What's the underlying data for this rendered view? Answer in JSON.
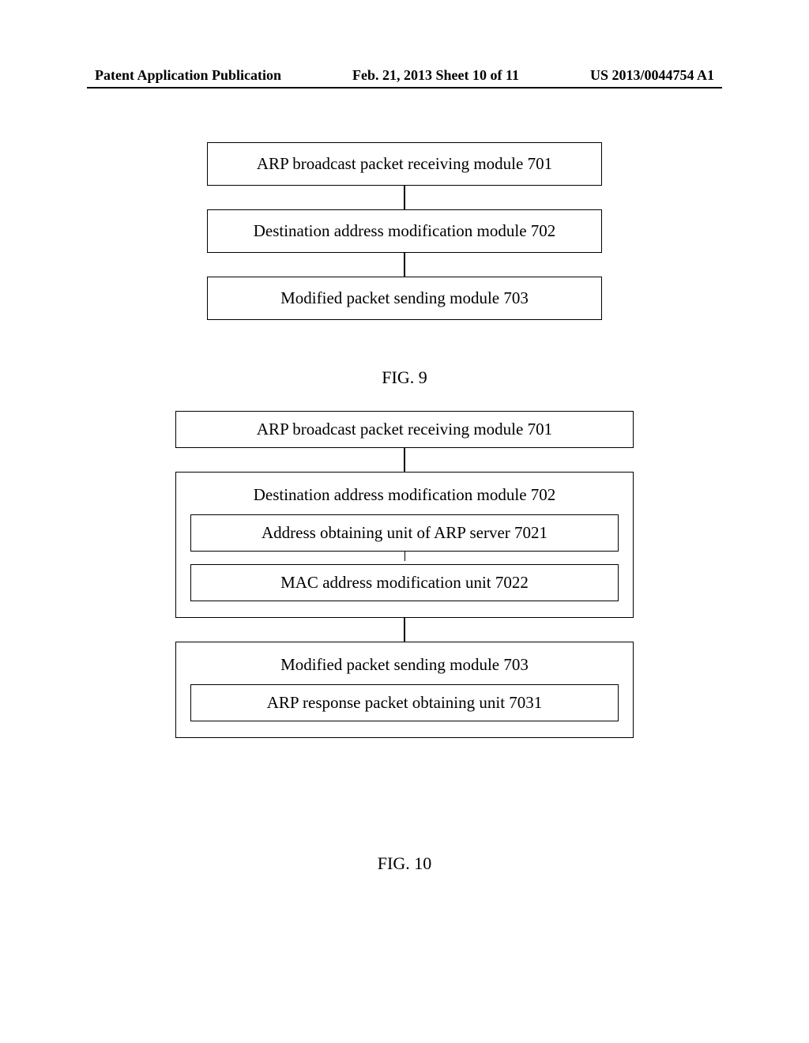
{
  "header": {
    "left": "Patent Application Publication",
    "center": "Feb. 21, 2013  Sheet 10 of 11",
    "right": "US 2013/0044754 A1"
  },
  "fig9": {
    "box1": "ARP broadcast packet receiving module 701",
    "box2": "Destination address modification module 702",
    "box3": "Modified packet sending module 703",
    "label": "FIG. 9"
  },
  "fig10": {
    "box1": "ARP broadcast packet receiving module 701",
    "box2": {
      "title": "Destination address modification module 702",
      "sub1": "Address obtaining unit of ARP server 7021",
      "sub2": "MAC address modification unit 7022"
    },
    "box3": {
      "title": "Modified packet sending module 703",
      "sub1": "ARP response packet obtaining unit 7031"
    },
    "label": "FIG. 10"
  }
}
